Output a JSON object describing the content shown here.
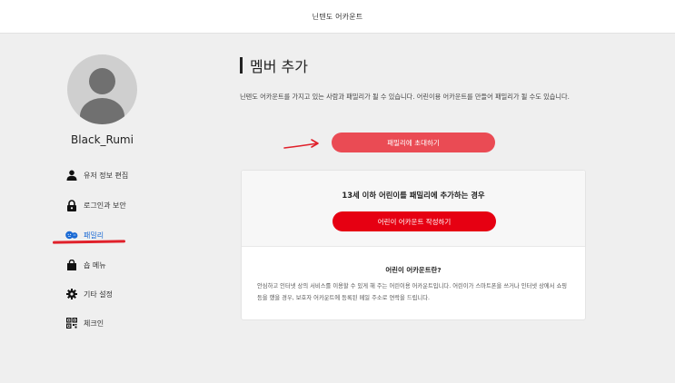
{
  "header": {
    "brand": "닌텐도 어카운트"
  },
  "user": {
    "name": "Black_Rumi"
  },
  "sidebar": {
    "items": [
      {
        "label": "유저 정보 편집",
        "icon": "person-icon"
      },
      {
        "label": "로그인과 보안",
        "icon": "lock-icon"
      },
      {
        "label": "패밀리",
        "icon": "family-icon",
        "active": true
      },
      {
        "label": "숍 메뉴",
        "icon": "shopping-bag-icon"
      },
      {
        "label": "기타 설정",
        "icon": "gear-icon"
      },
      {
        "label": "체크인",
        "icon": "qr-icon"
      }
    ]
  },
  "main": {
    "title": "멤버 추가",
    "description": "닌텐도 어카운트를 가지고 있는 사람과 패밀리가 될 수 있습니다. 어린이용 어카운트를 만들어 패밀리가 될 수도 있습니다.",
    "invite_button": "패밀리에 초대하기",
    "card": {
      "heading": "13세 이하 어린이를 패밀리에 추가하는 경우",
      "button": "어린이 어카운트 작성하기",
      "subheading": "어린이 어카운트란?",
      "body": "안심하고 인터넷 상의 서비스를 이용할 수 있게 해 주는 어린이용 어카운트입니다. 어린이가 스마트폰을 쓰거나 인터넷 상에서 쇼핑 등을 했을 경우, 보호자 어카운트에 등록된 메일 주소로 연락을 드립니다."
    }
  },
  "colors": {
    "invite_button": "#ea4b54",
    "child_button": "#e60012",
    "active_nav": "#1a6ad4",
    "annotation": "#e0202a"
  }
}
